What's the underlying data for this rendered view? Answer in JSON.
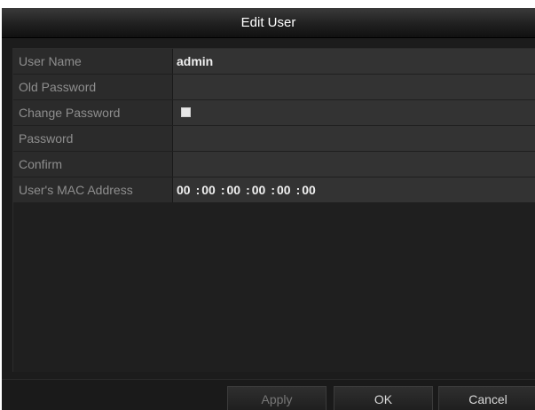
{
  "dialog": {
    "title": "Edit User"
  },
  "form": {
    "user_name": {
      "label": "User Name",
      "value": "admin"
    },
    "old_password": {
      "label": "Old Password",
      "value": ""
    },
    "change_password": {
      "label": "Change Password",
      "checked": true
    },
    "password": {
      "label": "Password",
      "value": ""
    },
    "confirm": {
      "label": "Confirm",
      "value": ""
    },
    "mac_address": {
      "label": "User's MAC Address",
      "octets": [
        "00",
        "00",
        "00",
        "00",
        "00",
        "00"
      ],
      "separator": ":"
    }
  },
  "buttons": {
    "apply": "Apply",
    "ok": "OK",
    "cancel": "Cancel"
  }
}
